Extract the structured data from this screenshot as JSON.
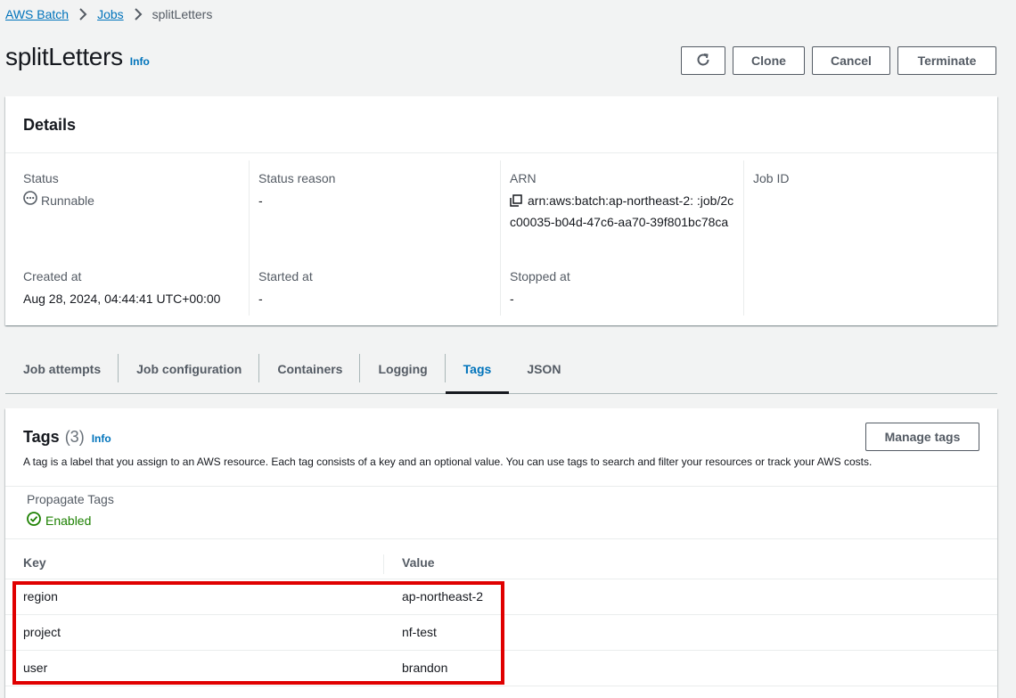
{
  "breadcrumb": {
    "items": [
      "AWS Batch",
      "Jobs"
    ],
    "current": "splitLetters"
  },
  "header": {
    "title": "splitLetters",
    "info": "Info",
    "buttons": {
      "clone": "Clone",
      "cancel": "Cancel",
      "terminate": "Terminate"
    }
  },
  "details": {
    "title": "Details",
    "status_label": "Status",
    "status_value": "Runnable",
    "status_reason_label": "Status reason",
    "status_reason_value": "-",
    "arn_label": "ARN",
    "arn_value": "arn:aws:batch:ap-northeast-2:                    :job/2cc00035-b04d-47c6-aa70-39f801bc78ca",
    "job_id_label": "Job ID",
    "created_label": "Created at",
    "created_value": "Aug 28, 2024, 04:44:41 UTC+00:00",
    "started_label": "Started at",
    "started_value": "-",
    "stopped_label": "Stopped at",
    "stopped_value": "-"
  },
  "tabs": [
    "Job attempts",
    "Job configuration",
    "Containers",
    "Logging",
    "Tags",
    "JSON"
  ],
  "active_tab": "Tags",
  "tags": {
    "title": "Tags",
    "count": "(3)",
    "info": "Info",
    "description": "A tag is a label that you assign to an AWS resource. Each tag consists of a key and an optional value. You can use tags to search and filter your resources or track your AWS costs.",
    "manage_button": "Manage tags",
    "propagate_label": "Propagate Tags",
    "propagate_value": "Enabled",
    "columns": {
      "key": "Key",
      "value": "Value"
    },
    "rows": [
      {
        "key": "region",
        "value": "ap-northeast-2"
      },
      {
        "key": "project",
        "value": "nf-test"
      },
      {
        "key": "user",
        "value": "brandon"
      }
    ]
  },
  "colors": {
    "link": "#0073bb",
    "success": "#1d8102",
    "highlight": "#e00000"
  }
}
